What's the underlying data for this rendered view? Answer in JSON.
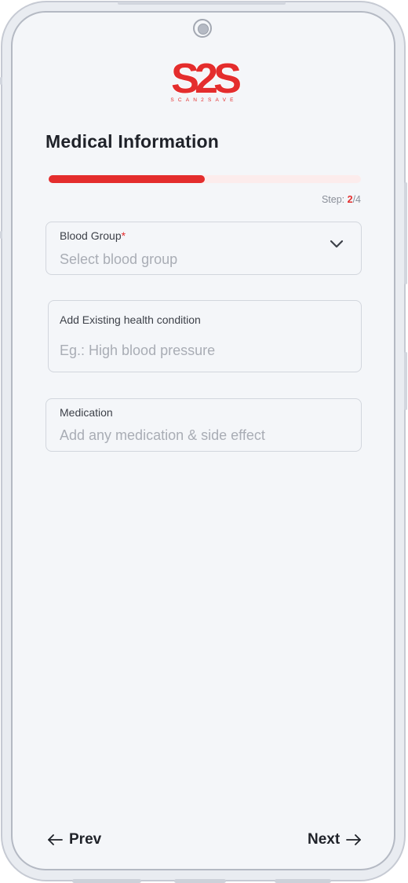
{
  "brand": {
    "logo_text": "S2S",
    "tagline": "SCAN2SAVE",
    "accent_color": "#e42d2d"
  },
  "page": {
    "title": "Medical Information"
  },
  "progress": {
    "fraction": 0.5,
    "step_prefix": "Step: ",
    "current_step": "2",
    "total_steps": "/4"
  },
  "form": {
    "blood_group": {
      "label": "Blood Group",
      "required_mark": "*",
      "placeholder": "Select blood group",
      "icon": "chevron-down-icon"
    },
    "health_condition": {
      "label": "Add Existing health condition",
      "placeholder": "Eg.: High blood pressure"
    },
    "medication": {
      "label": "Medication",
      "placeholder": "Add any medication & side effect"
    }
  },
  "navigation": {
    "prev_label": "Prev",
    "prev_icon": "arrow-left-icon",
    "next_label": "Next",
    "next_icon": "arrow-right-icon"
  }
}
